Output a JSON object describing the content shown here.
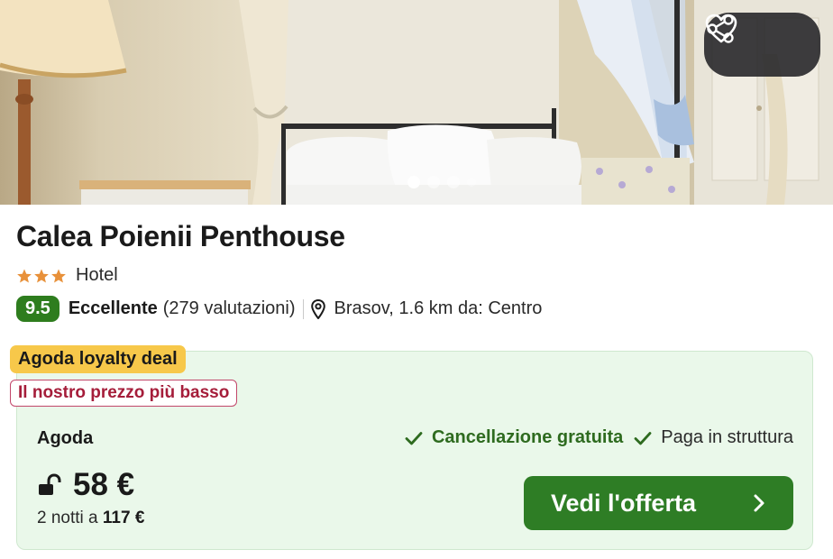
{
  "gallery": {
    "slide_count": 4,
    "active_slide": 1,
    "actions": {
      "share_icon": "share-icon",
      "favorite_icon": "heart-icon"
    }
  },
  "hotel": {
    "name": "Calea Poienii Penthouse",
    "star_rating": 3,
    "type": "Hotel",
    "score": "9.5",
    "verdict": "Eccellente",
    "reviews": "(279 valutazioni)",
    "location": "Brasov, 1.6 km da: Centro"
  },
  "deal": {
    "loyalty_badge": "Agoda loyalty deal",
    "lowest_badge": "Il nostro prezzo più basso",
    "provider": "Agoda",
    "free_cancellation": "Cancellazione gratuita",
    "pay_at_property": "Paga in struttura",
    "price": "58 €",
    "nights_prefix": "2 notti a",
    "total": "117 €",
    "cta_label": "Vedi l'offerta"
  },
  "colors": {
    "score_green": "#2e7d1e",
    "cta_green": "#2e7d25",
    "deal_bg": "#eaf8ea",
    "loyalty_yellow": "#f7c84a",
    "lowest_red": "#a51d3a",
    "star_orange": "#e8913a"
  }
}
